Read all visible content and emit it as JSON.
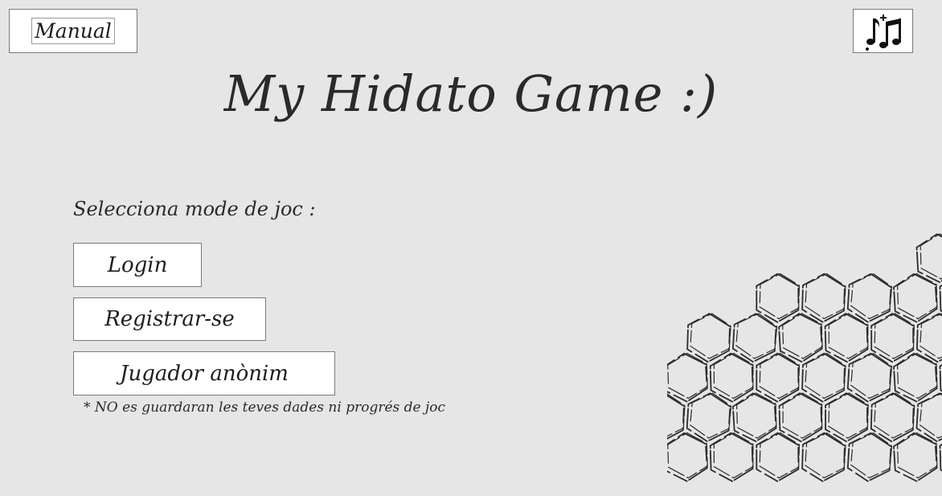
{
  "header": {
    "manual_label": "Manual",
    "music_icon": "music-notes-icon"
  },
  "title": "My Hidato Game :)",
  "mode_prompt": "Selecciona mode de joc :",
  "buttons": {
    "login": "Login",
    "register": "Registrar-se",
    "anonymous": "Jugador anònim"
  },
  "anonymous_note": "* NO es guardaran les teves dades ni progrés de joc",
  "decoration": {
    "icon": "honeycomb-icon"
  },
  "colors": {
    "background": "#e6e6e6",
    "button": "#ffffff",
    "ink": "#222222"
  }
}
